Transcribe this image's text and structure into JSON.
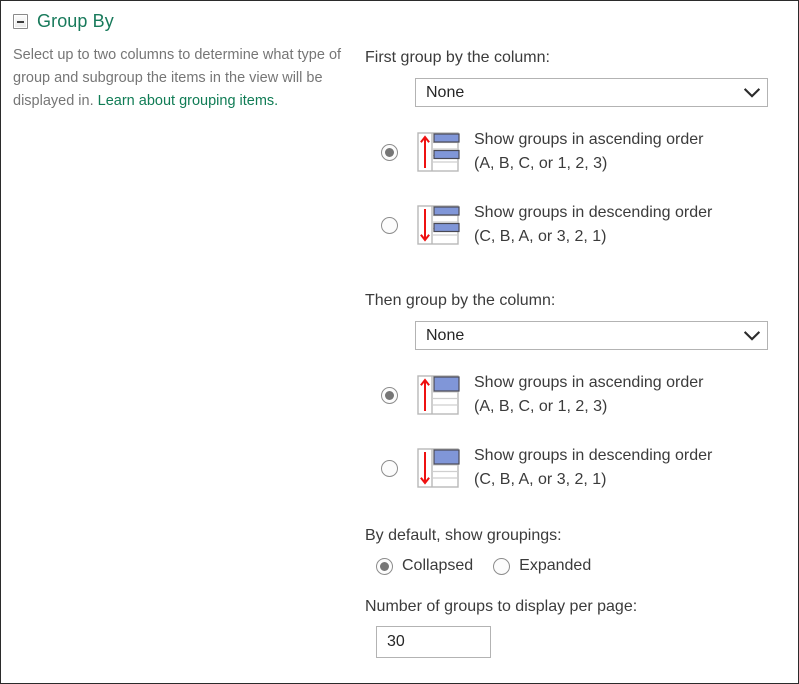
{
  "section": {
    "title": "Group By",
    "collapse_icon": "collapse-minus-icon",
    "description_text": "Select up to two columns to determine what type of group and subgroup the items in the view will be displayed in. ",
    "description_link": "Learn about grouping items.",
    "title_color": "#187a5b",
    "link_color": "#107c55",
    "body_text_color": "#767676"
  },
  "first_group": {
    "label": "First group by the column:",
    "select_value": "None",
    "select_arrow_icon": "chevron-down-icon",
    "ascending": {
      "label_main": "Show groups in ascending order",
      "label_sub": "(A, B, C, or 1, 2, 3)",
      "checked": true,
      "icon": "sort-ascending-table-icon"
    },
    "descending": {
      "label_main": "Show groups in descending order",
      "label_sub": "(C, B, A, or 3, 2, 1)",
      "checked": false,
      "icon": "sort-descending-table-icon"
    }
  },
  "then_group": {
    "label": "Then group by the column:",
    "select_value": "None",
    "select_arrow_icon": "chevron-down-icon",
    "ascending": {
      "label_main": "Show groups in ascending order",
      "label_sub": "(A, B, C, or 1, 2, 3)",
      "checked": true,
      "icon": "sort-ascending-table-icon"
    },
    "descending": {
      "label_main": "Show groups in descending order",
      "label_sub": "(C, B, A, or 3, 2, 1)",
      "checked": false,
      "icon": "sort-descending-table-icon"
    }
  },
  "defaults": {
    "label": "By default, show groupings:",
    "collapsed_label": "Collapsed",
    "expanded_label": "Expanded",
    "collapsed_checked": true,
    "expanded_checked": false
  },
  "groups_per_page": {
    "label": "Number of groups to display per page:",
    "value": "30",
    "placeholder": ""
  },
  "colors": {
    "accent_green": "#187a5b",
    "link_green": "#107c55",
    "arrow_red": "#ee1111",
    "table_blue": "#8096d8",
    "border_gray": "#b3b3b3"
  }
}
